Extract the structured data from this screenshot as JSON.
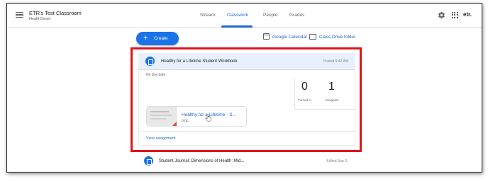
{
  "header": {
    "class_name": "ETR's Test Classroom",
    "class_subtitle": "HealthSmart",
    "logo_text": "etr."
  },
  "tabs": [
    {
      "label": "Stream",
      "active": false
    },
    {
      "label": "Classwork",
      "active": true
    },
    {
      "label": "People",
      "active": false
    },
    {
      "label": "Grades",
      "active": false
    }
  ],
  "toolbar": {
    "create_label": "Create",
    "google_calendar_label": "Google Calendar",
    "drive_folder_label": "Class Drive folder"
  },
  "assignment": {
    "title": "Healthy for a Lifetime Student Workbook",
    "posted": "Posted 9:42 AM",
    "due": "No due date",
    "turned_in_count": "0",
    "turned_in_label": "Turned in",
    "assigned_count": "1",
    "assigned_label": "Assigned",
    "attachment_title": "Healthy for a Lifetime - S...",
    "attachment_type": "PDF",
    "view_link": "View assignment"
  },
  "next_item": {
    "title": "Student Journal: Dimensions of Health: Mid...",
    "meta": "Edited Sep 3"
  },
  "colors": {
    "accent": "#1a73e8",
    "highlight_border": "#e0141a",
    "card_header_bg": "#e8f0fe"
  },
  "icons": [
    "menu-icon",
    "settings-gear-icon",
    "apps-grid-icon",
    "plus-icon",
    "calendar-icon",
    "folder-icon",
    "assignment-icon",
    "pdf-icon",
    "hand-cursor-icon"
  ]
}
